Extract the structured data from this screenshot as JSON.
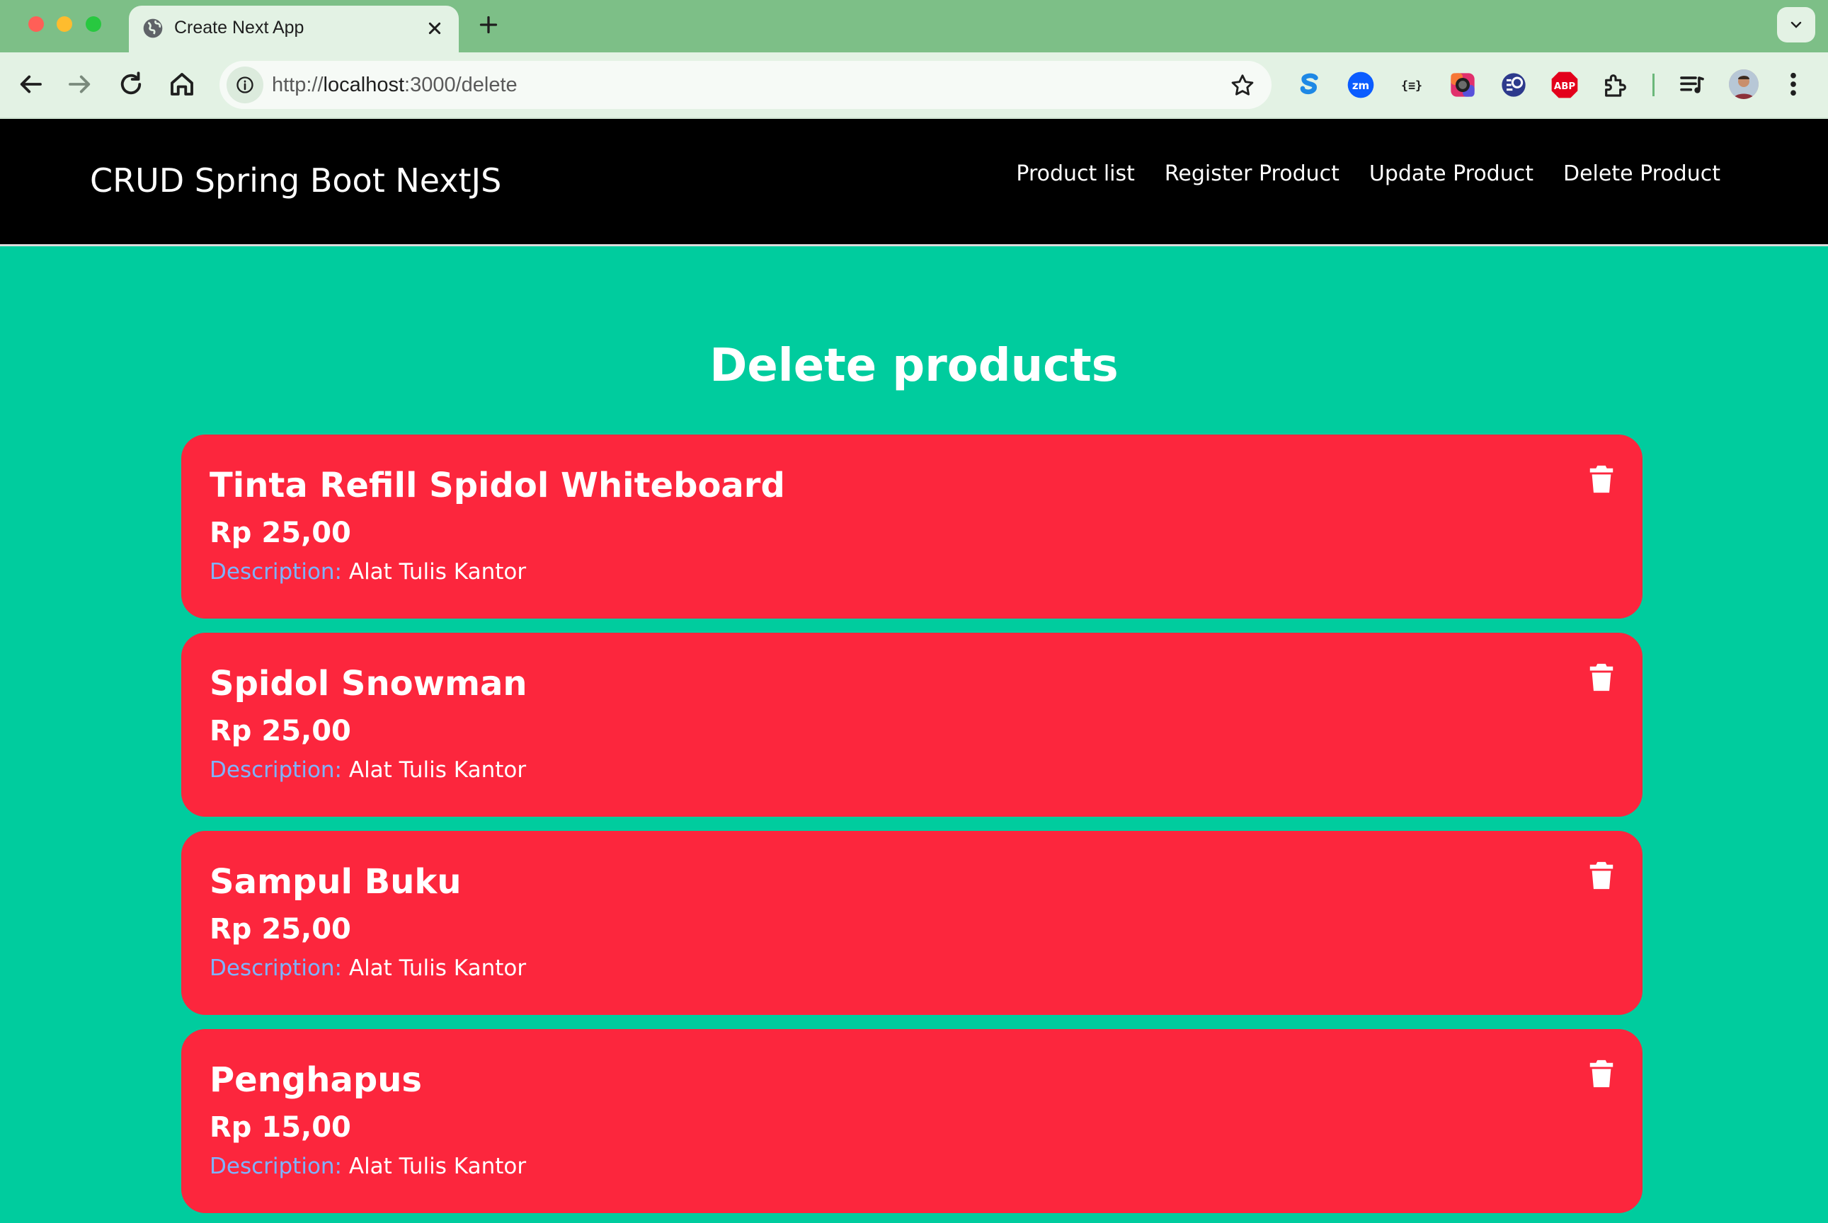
{
  "browser": {
    "tab_title": "Create Next App",
    "url_prefix": "http://",
    "url_host": "localhost",
    "url_path": ":3000/delete"
  },
  "navbar": {
    "brand": "CRUD Spring Boot NextJS",
    "links": [
      {
        "label": "Product list"
      },
      {
        "label": "Register Product"
      },
      {
        "label": "Update Product"
      },
      {
        "label": "Delete Product"
      }
    ]
  },
  "main": {
    "title": "Delete products",
    "description_label": "Description:",
    "products": [
      {
        "name": "Tinta Refill Spidol Whiteboard",
        "price": "Rp 25,00",
        "description": "Alat Tulis Kantor"
      },
      {
        "name": "Spidol Snowman",
        "price": "Rp 25,00",
        "description": "Alat Tulis Kantor"
      },
      {
        "name": "Sampul Buku",
        "price": "Rp 25,00",
        "description": "Alat Tulis Kantor"
      },
      {
        "name": "Penghapus",
        "price": "Rp 15,00",
        "description": "Alat Tulis Kantor"
      }
    ]
  },
  "icons": {
    "tab": "globe-icon",
    "card_action": "trash-icon"
  },
  "colors": {
    "page_background": "#00CC9E",
    "card_background": "#FC263D",
    "navbar_background": "#000000",
    "description_label": "#7EB3FF"
  }
}
